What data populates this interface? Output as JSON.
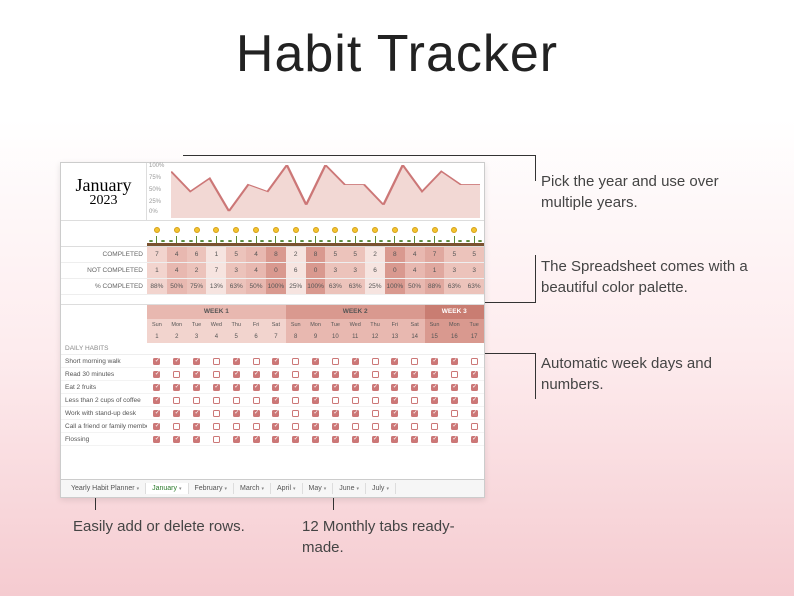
{
  "title": "Habit Tracker",
  "month": "January",
  "year": "2023",
  "callouts": {
    "year": "Pick the year and use over multiple years.",
    "palette": "The Spreadsheet comes with a beautiful color palette.",
    "weekdays": "Automatic week days and numbers.",
    "rows": "Easily add or delete rows.",
    "tabs": "12 Monthly tabs ready-made."
  },
  "chart_data": {
    "type": "area",
    "title": "",
    "xlabel": "",
    "ylabel": "",
    "ylim": [
      0,
      100
    ],
    "yticks": [
      "100%",
      "75%",
      "50%",
      "25%",
      "0%"
    ],
    "values": [
      88,
      50,
      75,
      13,
      63,
      50,
      100,
      25,
      100,
      63,
      63,
      25,
      100,
      50,
      88,
      63,
      63
    ]
  },
  "stats": {
    "completed": {
      "label": "COMPLETED",
      "values": [
        7,
        4,
        6,
        1,
        5,
        4,
        8,
        2,
        8,
        5,
        5,
        2,
        8,
        4,
        7,
        5,
        5
      ]
    },
    "notCompleted": {
      "label": "NOT COMPLETED",
      "values": [
        1,
        4,
        2,
        7,
        3,
        4,
        0,
        6,
        0,
        3,
        3,
        6,
        0,
        4,
        1,
        3,
        3
      ]
    },
    "pctCompleted": {
      "label": "% COMPLETED",
      "values": [
        "88%",
        "50%",
        "75%",
        "13%",
        "63%",
        "50%",
        "100%",
        "25%",
        "100%",
        "63%",
        "63%",
        "25%",
        "100%",
        "50%",
        "88%",
        "63%",
        "63%"
      ]
    }
  },
  "stat_colors": [
    "#f2d4ce",
    "#e8b8b0",
    "#ecc3bb",
    "#f6e4e0",
    "#ecc3bb",
    "#e8b8b0",
    "#d9998f",
    "#f6e4e0",
    "#d9998f",
    "#ecc3bb",
    "#ecc3bb",
    "#f6e4e0",
    "#d9998f",
    "#e8b8b0",
    "#e0a89f",
    "#ecc3bb",
    "#ecc3bb"
  ],
  "weeks": [
    "WEEK 1",
    "WEEK 2",
    "WEEK 3"
  ],
  "days": [
    "Sun",
    "Mon",
    "Tue",
    "Wed",
    "Thu",
    "Fri",
    "Sat",
    "Sun",
    "Mon",
    "Tue",
    "Wed",
    "Thu",
    "Fri",
    "Sat",
    "Sun",
    "Mon",
    "Tue"
  ],
  "nums": [
    1,
    2,
    3,
    4,
    5,
    6,
    7,
    8,
    9,
    10,
    11,
    12,
    13,
    14,
    15,
    16,
    17
  ],
  "daily_habits_label": "DAILY HABITS",
  "habits": [
    {
      "name": "Short morning walk",
      "cells": [
        1,
        1,
        1,
        0,
        1,
        0,
        1,
        0,
        1,
        0,
        1,
        0,
        1,
        0,
        1,
        1,
        0
      ]
    },
    {
      "name": "Read 30 minutes",
      "cells": [
        1,
        0,
        1,
        0,
        1,
        1,
        1,
        0,
        1,
        1,
        1,
        0,
        1,
        1,
        1,
        0,
        1
      ]
    },
    {
      "name": "Eat 2 fruits",
      "cells": [
        1,
        1,
        1,
        1,
        1,
        1,
        1,
        1,
        1,
        1,
        1,
        1,
        1,
        1,
        1,
        1,
        1
      ]
    },
    {
      "name": "Less than 2 cups of coffee",
      "cells": [
        1,
        0,
        0,
        0,
        0,
        0,
        1,
        0,
        1,
        0,
        0,
        0,
        1,
        0,
        1,
        1,
        1
      ]
    },
    {
      "name": "Work with stand-up desk",
      "cells": [
        1,
        1,
        1,
        0,
        1,
        1,
        1,
        0,
        1,
        1,
        1,
        0,
        1,
        1,
        1,
        0,
        1
      ]
    },
    {
      "name": "Call a friend or family member",
      "cells": [
        1,
        0,
        1,
        0,
        0,
        0,
        1,
        0,
        1,
        1,
        0,
        0,
        1,
        0,
        0,
        1,
        0
      ]
    },
    {
      "name": "Flossing",
      "cells": [
        1,
        1,
        1,
        0,
        1,
        1,
        1,
        1,
        1,
        1,
        1,
        1,
        1,
        1,
        1,
        1,
        1
      ]
    }
  ],
  "tabs": [
    "Yearly Habit Planner",
    "January",
    "February",
    "March",
    "April",
    "May",
    "June",
    "July"
  ],
  "active_tab": 1
}
